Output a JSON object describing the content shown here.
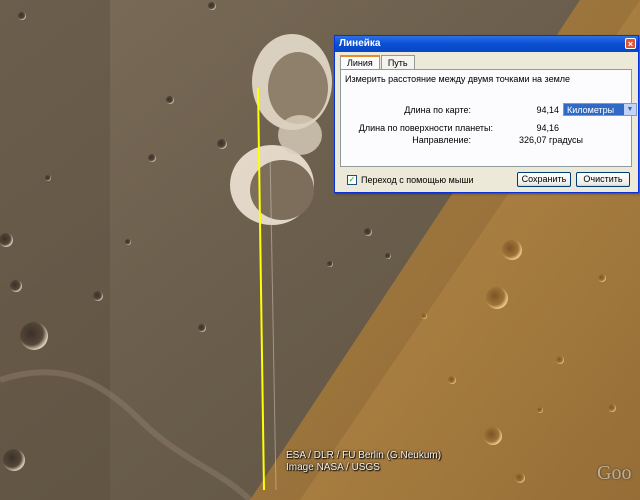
{
  "map": {
    "attribution": [
      "ESA / DLR / FU Berlin (G.Neukum)",
      "Image NASA / USGS"
    ],
    "logo": "Goo"
  },
  "dialog": {
    "title": "Линейка",
    "close_icon": "close-icon",
    "tabs": [
      {
        "label": "Линия",
        "active": true
      },
      {
        "label": "Путь",
        "active": false
      }
    ],
    "description": "Измерить расстояние между двумя точками на земле",
    "map_length_label": "Длина по карте:",
    "map_length_value": "94,14",
    "unit_select": "Километры",
    "surface_length_label": "Длина по поверхности планеты:",
    "surface_length_value": "94,16",
    "direction_label": "Направление:",
    "direction_value": "326,07 градусы",
    "mouse_nav_label": "Переход с помощью мыши",
    "mouse_nav_checked": true,
    "save_button": "Сохранить",
    "clear_button": "Очистить"
  },
  "colors": {
    "ruler_line": "#ffff00",
    "titlebar": "#0a4fd2",
    "selection": "#316ac5"
  }
}
